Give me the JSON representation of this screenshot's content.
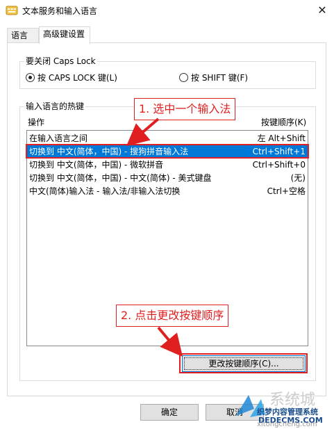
{
  "window": {
    "title": "文本服务和输入语言",
    "close_glyph": "✕"
  },
  "tabs": [
    {
      "label": "语言栏"
    },
    {
      "label": "高级键设置"
    }
  ],
  "caps_group": {
    "label": "要关闭 Caps Lock",
    "option_caps": "按 CAPS LOCK 键(L)",
    "option_shift": "按 SHIFT 键(F)",
    "selected": "caps"
  },
  "hotkeys_group": {
    "label": "输入语言的热键",
    "col_action": "操作",
    "col_key": "按键顺序(K)",
    "rows": [
      {
        "action": "在输入语言之间",
        "key": "左 Alt+Shift"
      },
      {
        "action": "切换到 中文(简体，中国) - 搜狗拼音输入法",
        "key": "Ctrl+Shift+1"
      },
      {
        "action": "切换到 中文(简体，中国) - 微软拼音",
        "key": "Ctrl+Shift+0"
      },
      {
        "action": "切换到 中文(简体，中国) - 中文(简体) - 美式键盘",
        "key": "(无)"
      },
      {
        "action": "中文(简体)输入法 - 输入法/非输入法切换",
        "key": "Ctrl+空格"
      }
    ],
    "selected_index": 1,
    "change_button": "更改按键顺序(C)..."
  },
  "footer": {
    "ok_button": "确定",
    "cancel_button": "取消"
  },
  "annotations": {
    "step1": "1. 选中一个输入法",
    "step2": "2. 点击更改按键顺序",
    "color": "#e02020"
  },
  "watermark": {
    "line1": "织梦内容管理系统",
    "line2": "DEDECMS.COM",
    "line3": "xitongcheng.com",
    "logo_text": "系统城"
  },
  "colors": {
    "selection": "#0078d7",
    "annotation_red": "#e02020"
  }
}
